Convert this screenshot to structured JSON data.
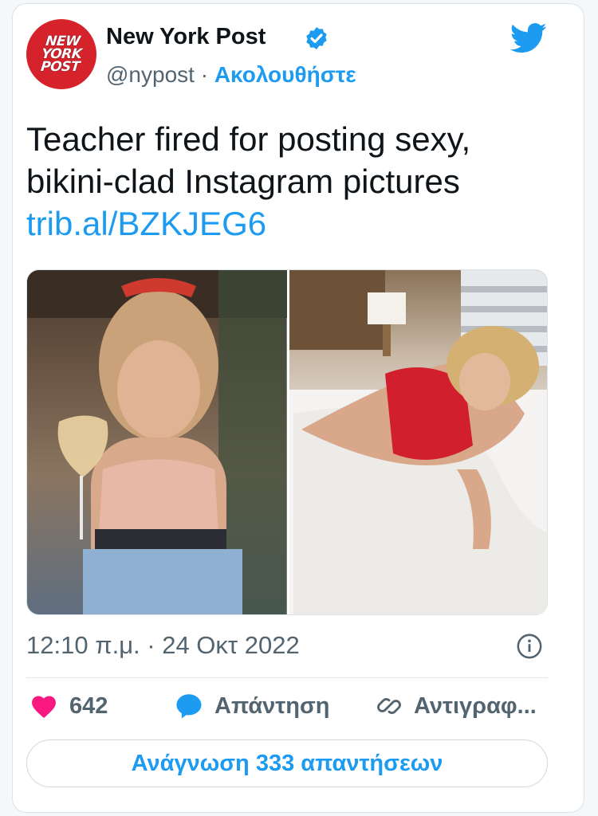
{
  "author": {
    "name": "New York Post",
    "handle": "@nypost",
    "separator": "·",
    "follow_label": "Ακολουθήστε",
    "avatar_text_line1": "NEW",
    "avatar_text_line2": "YORK",
    "avatar_text_line3": "POST"
  },
  "tweet": {
    "text": "Teacher fired for posting sexy, bikini-clad Instagram pictures",
    "link": "trib.al/BZKJEG6",
    "timestamp": "12:10 π.μ. · 24 Οκτ 2022"
  },
  "actions": {
    "like_count": "642",
    "reply_label": "Απάντηση",
    "copy_label": "Αντιγραφ..."
  },
  "read_replies_label": "Ανάγνωση 333 απαντήσεων",
  "icons": {
    "verified": "verified-badge-icon",
    "twitter": "twitter-bird-icon",
    "info": "info-icon",
    "like": "heart-icon",
    "reply": "speech-bubble-icon",
    "copy": "link-icon"
  },
  "colors": {
    "accent": "#1d9bf0",
    "like": "#f91880",
    "avatar_bg": "#d6222b",
    "text": "#0f1419",
    "secondary": "#536471"
  }
}
